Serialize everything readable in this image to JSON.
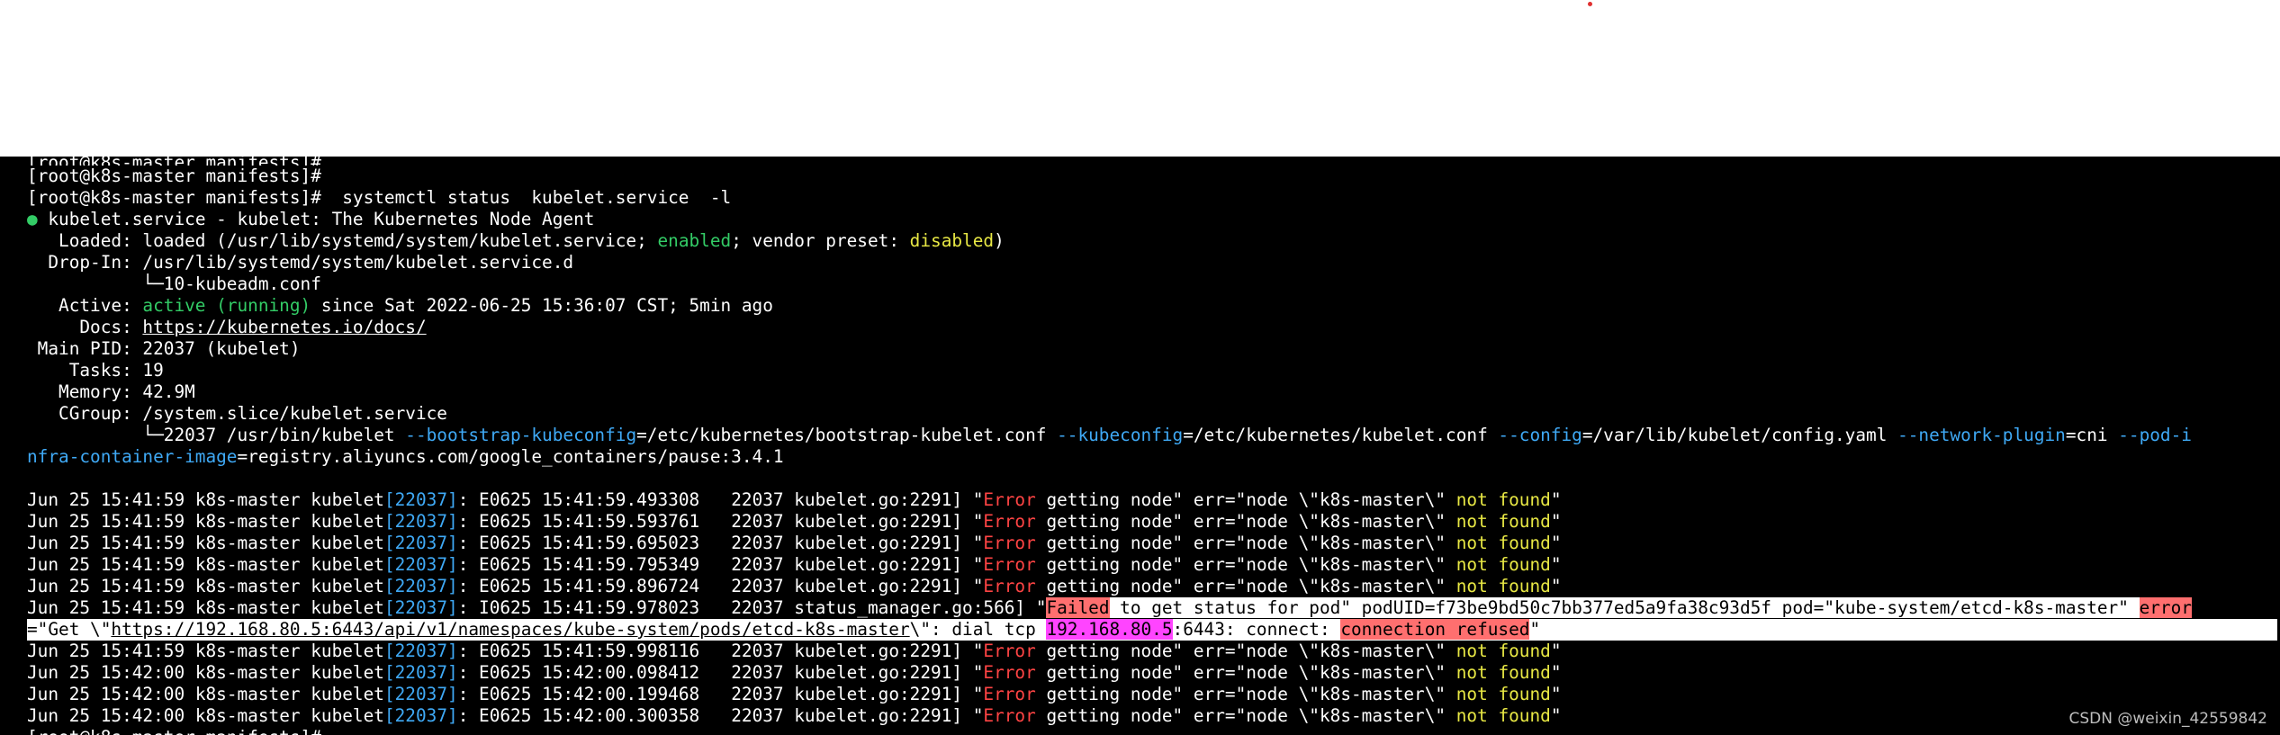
{
  "terminal": {
    "prompt": "[root@k8s-master manifests]#",
    "command": "  systemctl status  kubelet.service  -l",
    "service_title": "kubelet.service - kubelet: The Kubernetes Node Agent",
    "status_dot": "●",
    "loaded": {
      "label": "   Loaded: ",
      "text1": "loaded (/usr/lib/systemd/system/kubelet.service; ",
      "enabled": "enabled",
      "text2": "; vendor preset: ",
      "disabled": "disabled",
      "text3": ")"
    },
    "dropin": {
      "label": "  Drop-In: ",
      "path": "/usr/lib/systemd/system/kubelet.service.d",
      "child": "           └─10-kubeadm.conf"
    },
    "active": {
      "label": "   Active: ",
      "state": "active (running)",
      "rest": " since Sat 2022-06-25 15:36:07 CST; 5min ago"
    },
    "docs": {
      "label": "     Docs: ",
      "url": "https://kubernetes.io/docs/"
    },
    "main_pid": {
      "label": " Main PID: ",
      "value": "22037 (kubelet)"
    },
    "tasks": {
      "label": "    Tasks: ",
      "value": "19"
    },
    "memory": {
      "label": "   Memory: ",
      "value": "42.9M"
    },
    "cgroup": {
      "label": "   CGroup: ",
      "value": "/system.slice/kubelet.service"
    },
    "cmdline": {
      "prefix": "           └─22037 /usr/bin/kubelet ",
      "flag1": "--bootstrap-kubeconfig",
      "val1": "=/etc/kubernetes/bootstrap-kubelet.conf ",
      "flag2": "--kubeconfig",
      "val2": "=/etc/kubernetes/kubelet.conf ",
      "flag3": "--config",
      "val3": "=/var/lib/kubelet/config.yaml ",
      "flag4": "--network-plugin",
      "val4": "=cni ",
      "flag5a": "--pod-i",
      "flag5b": "nfra-container-image",
      "val5": "=registry.aliyuncs.com/google_containers/pause:3.4.1"
    },
    "log_prefix": "Jun 25 ",
    "host_proc": " k8s-master kubelet",
    "pid_bracket": "[22037]",
    "err_word": "Error",
    "err_mid": " getting node\" err=\"node \\\"k8s-master\\\" ",
    "not_found": "not found",
    "logs_before": [
      {
        "time": "15:41:59",
        "code": ": E0625 15:41:59.493308   22037 kubelet.go:2291] \""
      },
      {
        "time": "15:41:59",
        "code": ": E0625 15:41:59.593761   22037 kubelet.go:2291] \""
      },
      {
        "time": "15:41:59",
        "code": ": E0625 15:41:59.695023   22037 kubelet.go:2291] \""
      },
      {
        "time": "15:41:59",
        "code": ": E0625 15:41:59.795349   22037 kubelet.go:2291] \""
      },
      {
        "time": "15:41:59",
        "code": ": E0625 15:41:59.896724   22037 kubelet.go:2291] \""
      }
    ],
    "status_log": {
      "time": "15:41:59",
      "code": ": I0625 15:41:59.978023   22037 status_manager.go:566] \"",
      "failed": "Failed",
      "msg": " to get status for pod\" podUID=f73be9bd50c7bb377ed5a9fa38c93d5f pod=\"kube-system/etcd-k8s-master\" ",
      "error_word": "error",
      "wrap_a": "=\"Get \\\"",
      "url": "https://192.168.80.5:6443/api/v1/namespaces/kube-system/pods/etcd-k8s-master",
      "wrap_b": "\\\": dial tcp ",
      "ip": "192.168.80.5",
      "wrap_c": ":6443: connect: ",
      "refused": "connection refused",
      "wrap_d": "\""
    },
    "logs_after": [
      {
        "time": "15:41:59",
        "code": ": E0625 15:41:59.998116   22037 kubelet.go:2291] \""
      },
      {
        "time": "15:42:00",
        "code": ": E0625 15:42:00.098412   22037 kubelet.go:2291] \""
      },
      {
        "time": "15:42:00",
        "code": ": E0625 15:42:00.199468   22037 kubelet.go:2291] \""
      },
      {
        "time": "15:42:00",
        "code": ": E0625 15:42:00.300358   22037 kubelet.go:2291] \""
      }
    ],
    "quote_end": "\""
  },
  "watermark": "CSDN @weixin_42559842",
  "colors": {
    "background": "#000000",
    "green": "#33cc66",
    "yellow": "#e8e844",
    "cyan": "#3fa9f5",
    "red": "#ff4444",
    "highlight_red": "#ff6f6f",
    "highlight_magenta": "#ff44ff"
  }
}
